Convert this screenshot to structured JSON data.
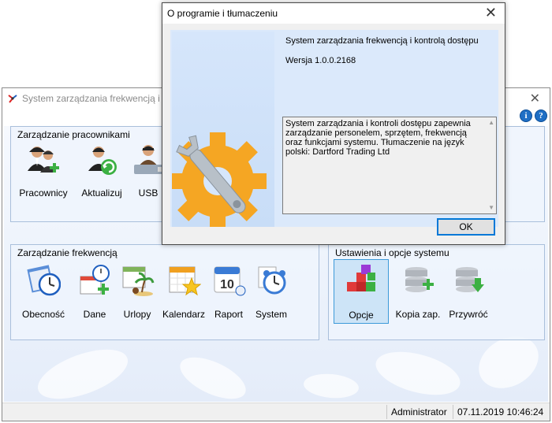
{
  "main_window": {
    "title": "System zarządzania frekwencją i ko",
    "close_glyph": "✕",
    "info_glyph": "i",
    "help_glyph": "?"
  },
  "panels": {
    "employees": {
      "title": "Zarządzanie pracownikami",
      "buttons": [
        {
          "label": "Pracownicy",
          "icon": "employees-add-icon"
        },
        {
          "label": "Aktualizuj",
          "icon": "employee-refresh-icon"
        },
        {
          "label": "USB",
          "icon": "usb-employee-icon"
        }
      ]
    },
    "attendance": {
      "title": "Zarządzanie frekwencją",
      "buttons": [
        {
          "label": "Obecność",
          "icon": "calendar-clock-icon"
        },
        {
          "label": "Dane",
          "icon": "data-add-icon"
        },
        {
          "label": "Urlopy",
          "icon": "vacation-icon"
        },
        {
          "label": "Kalendarz",
          "icon": "calendar-star-icon"
        },
        {
          "label": "Raport",
          "icon": "report-calendar-icon"
        },
        {
          "label": "System",
          "icon": "alarm-clock-icon"
        }
      ]
    },
    "settings": {
      "title": "Ustawienia i opcje systemu",
      "buttons": [
        {
          "label": "Opcje",
          "icon": "options-cubes-icon"
        },
        {
          "label": "Kopia zap.",
          "icon": "database-backup-icon"
        },
        {
          "label": "Przywróć",
          "icon": "database-restore-icon"
        }
      ]
    }
  },
  "statusbar": {
    "user": "Administrator",
    "datetime": "07.11.2019 10:46:24"
  },
  "dialog": {
    "title": "O programie i tłumaczeniu",
    "close_glyph": "✕",
    "product_name": "System zarządzania frekwencją i kontrolą dostępu",
    "version": "Wersja 1.0.0.2168",
    "description": "System zarządzania i kontroli dostępu zapewnia zarządzanie personelem, sprzętem, frekwencją oraz funkcjami systemu. Tłumaczenie na język polski: Dartford Trading Ltd",
    "ok_label": "OK"
  },
  "colors": {
    "accent": "#0078d7",
    "gear_orange": "#f5a623",
    "panel_border": "#a9bfdb"
  }
}
